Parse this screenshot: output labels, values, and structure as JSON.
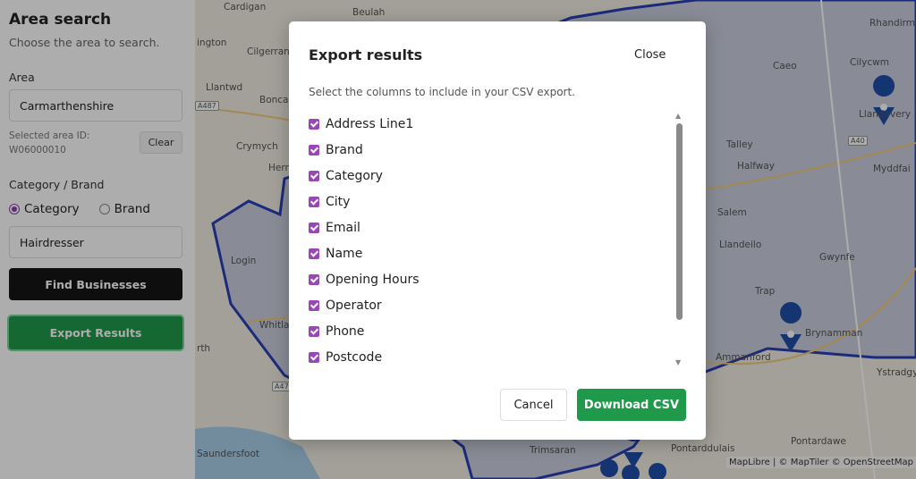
{
  "sidebar": {
    "title": "Area search",
    "subtitle": "Choose the area to search.",
    "area_label": "Area",
    "area_value": "Carmarthenshire",
    "selected_area_label": "Selected area ID:",
    "selected_area_id": "W06000010",
    "clear_label": "Clear",
    "category_brand_label": "Category / Brand",
    "radio_category": "Category",
    "radio_brand": "Brand",
    "selected_radio": "Category",
    "category_value": "Hairdresser",
    "find_label": "Find Businesses",
    "export_label": "Export Results"
  },
  "map": {
    "places": [
      "Cardigan",
      "Beulah",
      "Rhandirmwyn",
      "Cilgerran",
      "Caeo",
      "Cilycwm",
      "Llantwd",
      "Boncath",
      "Llandovery",
      "Crymych",
      "Talley",
      "Halfway",
      "Myddfai",
      "Hermon",
      "Salem",
      "Llandeilo",
      "Gwynfe",
      "Login",
      "Trap",
      "Whitland",
      "Brynamman",
      "Ammanford",
      "Ystradgynlais",
      "Trimsaran",
      "Pontarddulais",
      "Pontardawe",
      "Saundersfoot",
      "ington",
      "rth"
    ],
    "roads": [
      "A487",
      "A40",
      "A47"
    ],
    "attribution": "MapLibre | © MapTiler © OpenStreetMap"
  },
  "modal": {
    "title": "Export results",
    "close_label": "Close",
    "description": "Select the columns to include in your CSV export.",
    "columns": [
      {
        "label": "Address Line1",
        "checked": true
      },
      {
        "label": "Brand",
        "checked": true
      },
      {
        "label": "Category",
        "checked": true
      },
      {
        "label": "City",
        "checked": true
      },
      {
        "label": "Email",
        "checked": true
      },
      {
        "label": "Name",
        "checked": true
      },
      {
        "label": "Opening Hours",
        "checked": true
      },
      {
        "label": "Operator",
        "checked": true
      },
      {
        "label": "Phone",
        "checked": true
      },
      {
        "label": "Postcode",
        "checked": true
      }
    ],
    "cancel_label": "Cancel",
    "download_label": "Download CSV"
  },
  "colors": {
    "accent_purple": "#9b46b8",
    "green": "#1f9a4a",
    "pin_blue": "#1e4fa8"
  }
}
